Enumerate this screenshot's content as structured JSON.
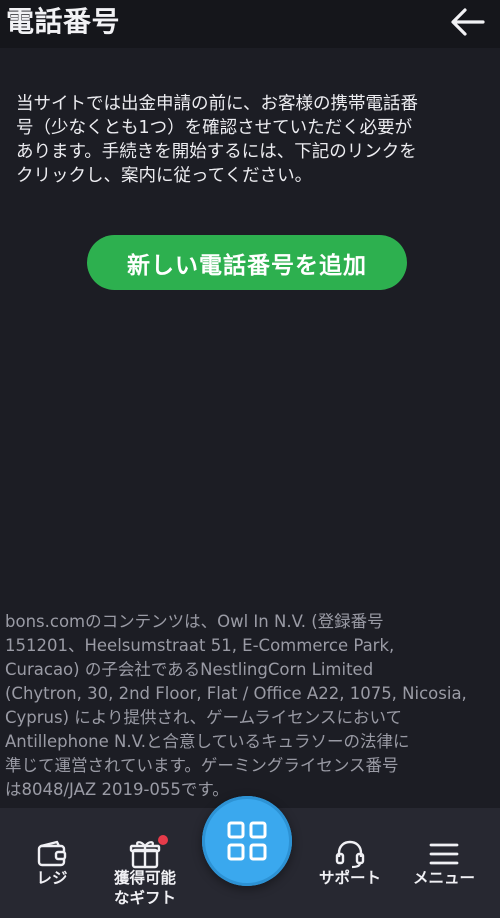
{
  "header": {
    "title": "電話番号",
    "back_icon": "arrow-left-icon"
  },
  "main": {
    "intro_text": "当サイトでは出金申請の前に、お客様の携帯電話番\n号（少なくとも1つ）を確認させていただく必要が\nあります。手続きを開始するには、下記のリンクを\nクリックし、案内に従ってください。",
    "add_phone_label": "新しい電話番号を追加"
  },
  "footer": {
    "legal_text": "bons.comのコンテンツは、Owl In N.V. (登録番号\n151201、Heelsumstraat 51, E-Commerce Park,\nCuracao) の子会社であるNestlingCorn Limited\n(Chytron, 30, 2nd Floor, Flat / Office A22, 1075, Nicosia,\nCyprus) により提供され、ゲームライセンスにおいて\nAntillephone N.V.と合意しているキュラソーの法律に\n準じて運営されています。ゲーミングライセンス番号\nは8048/JAZ 2019-055です。"
  },
  "bottom_nav": {
    "items": [
      {
        "label": "レジ",
        "icon": "wallet-icon"
      },
      {
        "label": "獲得可能\nなギフト",
        "icon": "gift-icon",
        "badge": true
      },
      {
        "label": "サポート",
        "icon": "headset-icon"
      },
      {
        "label": "メニュー",
        "icon": "hamburger-menu-icon"
      }
    ],
    "home_icon": "grid-icon"
  },
  "colors": {
    "background": "#1c1d24",
    "header_bg": "#15161b",
    "primary_button": "#2db04f",
    "nav_bg": "#272831",
    "home_button": "#3aa8ee",
    "badge": "#e63b4a"
  }
}
